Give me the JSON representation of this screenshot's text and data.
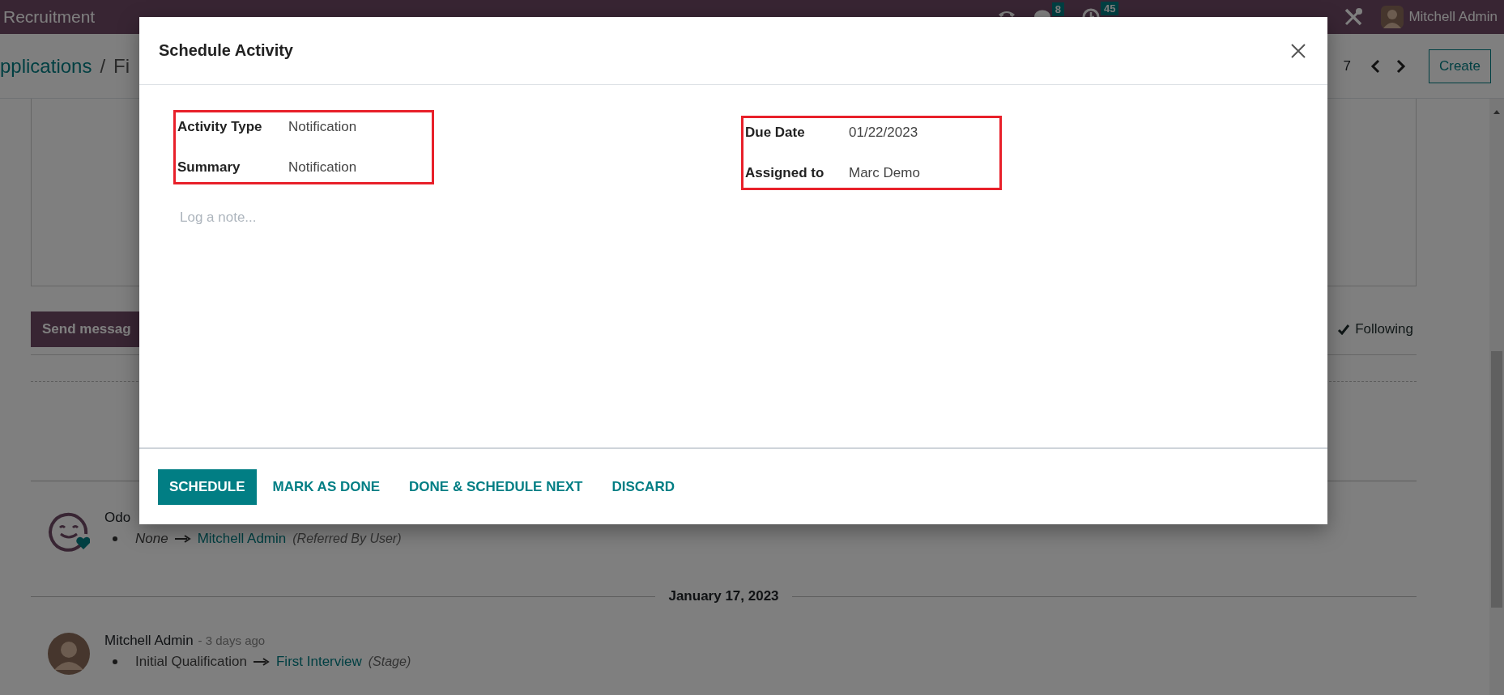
{
  "topbar": {
    "app_name": "Recruitment",
    "chat_count": "8",
    "activity_count": "45",
    "user": "Mitchell Admin"
  },
  "control_panel": {
    "crumbs": [
      "pplications",
      "Fi"
    ],
    "separator": "/",
    "pager": "7",
    "create_button": "Create"
  },
  "chatter": {
    "send_button": "Send messag",
    "follow_button": "Following",
    "items": [
      {
        "kind": "bot_message",
        "author": "Odo",
        "change": {
          "old": "None",
          "old_empty": true,
          "new": "Mitchell Admin",
          "field": "(Referred By User)"
        }
      },
      {
        "kind": "separator",
        "text": "January 17, 2023"
      },
      {
        "kind": "user_message",
        "author": "Mitchell Admin",
        "time": "- 3 days ago",
        "change": {
          "old": "Initial Qualification",
          "old_empty": false,
          "new": "First Interview",
          "field": "(Stage)"
        }
      }
    ]
  },
  "modal": {
    "title": "Schedule Activity",
    "field_groups": [
      {
        "highlighted": true,
        "fields": [
          {
            "label": "Activity Type",
            "value": "Notification"
          },
          {
            "label": "Summary",
            "value": "Notification"
          }
        ]
      },
      {
        "highlighted": true,
        "fields": [
          {
            "label": "Due Date",
            "value": "01/22/2023"
          },
          {
            "label": "Assigned to",
            "value": "Marc Demo"
          }
        ]
      }
    ],
    "note_placeholder": "Log a note...",
    "buttons": [
      {
        "label": "SCHEDULE",
        "primary": true
      },
      {
        "label": "MARK AS DONE",
        "primary": false
      },
      {
        "label": "DONE & SCHEDULE NEXT",
        "primary": false
      },
      {
        "label": "DISCARD",
        "primary": false
      }
    ]
  }
}
